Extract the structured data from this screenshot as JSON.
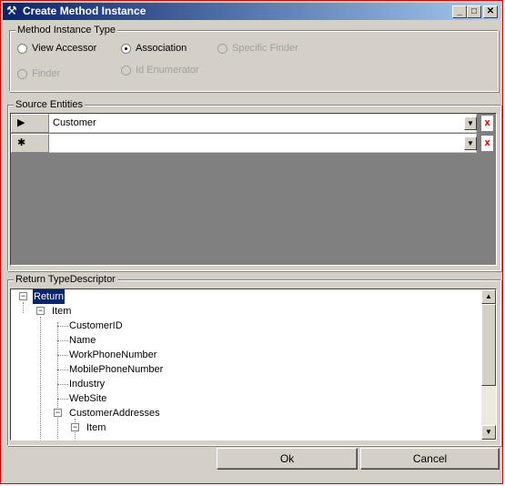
{
  "window": {
    "title": "Create Method Instance"
  },
  "titlebar_buttons": {
    "minimize": "_",
    "maximize": "□",
    "close": "✕"
  },
  "method_instance_type": {
    "legend": "Method Instance Type",
    "options": [
      {
        "label": "View Accessor",
        "checked": false,
        "enabled": true
      },
      {
        "label": "Association",
        "checked": true,
        "enabled": true
      },
      {
        "label": "Specific Finder",
        "checked": false,
        "enabled": false
      },
      {
        "label": "Finder",
        "checked": false,
        "enabled": false
      },
      {
        "label": "Id Enumerator",
        "checked": false,
        "enabled": false
      }
    ]
  },
  "source_entities": {
    "legend": "Source Entities",
    "rows": [
      {
        "indicator": "▶",
        "value": "Customer"
      },
      {
        "indicator": "✱",
        "value": ""
      }
    ],
    "dropdown_glyph": "▼",
    "delete_glyph": "x"
  },
  "return_type": {
    "legend": "Return TypeDescriptor",
    "nodes": [
      {
        "label": "Return",
        "expanded": true,
        "selected": true
      },
      {
        "label": "Item",
        "expanded": true
      },
      {
        "label": "CustomerID"
      },
      {
        "label": "Name"
      },
      {
        "label": "WorkPhoneNumber"
      },
      {
        "label": "MobilePhoneNumber"
      },
      {
        "label": "Industry"
      },
      {
        "label": "WebSite"
      },
      {
        "label": "CustomerAddresses",
        "expanded": true
      },
      {
        "label": "Item",
        "expanded": true
      }
    ],
    "expander_glyph": "−"
  },
  "buttons": {
    "ok": "Ok",
    "cancel": "Cancel"
  }
}
